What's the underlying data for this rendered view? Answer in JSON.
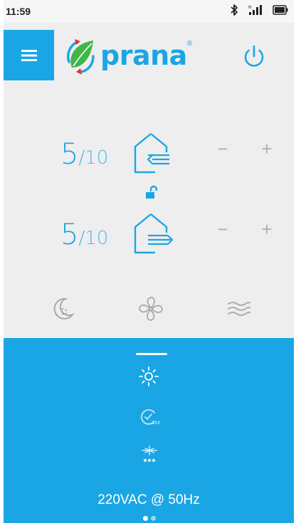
{
  "status_bar": {
    "time": "11:59",
    "icons": [
      "bluetooth-icon",
      "signal-icon",
      "battery-icon"
    ]
  },
  "header": {
    "menu_icon": "hamburger-icon",
    "brand": "prana",
    "brand_mark": "®",
    "power_icon": "power-icon"
  },
  "intake": {
    "speed_current": "5",
    "speed_max": "/10",
    "minus": "−",
    "plus": "+",
    "icon": "intake-house-icon"
  },
  "exhaust": {
    "speed_current": "5",
    "speed_max": "/10",
    "minus": "−",
    "plus": "+",
    "icon": "exhaust-house-icon"
  },
  "lock_icon": "unlocked-padlock-icon",
  "modes": [
    "night-mode-icon",
    "fan-icon",
    "airflow-waves-icon"
  ],
  "panel": {
    "icons": [
      "heater-sun-icon",
      "sleep-timer-icon",
      "defrost-snowflake-icon"
    ],
    "voltage": "220VAC @ 50Hz",
    "pages": 2,
    "active_page": 1
  },
  "colors": {
    "accent": "#1aa6e4",
    "background": "#eeeeee",
    "inactive": "#b0b0b0"
  }
}
